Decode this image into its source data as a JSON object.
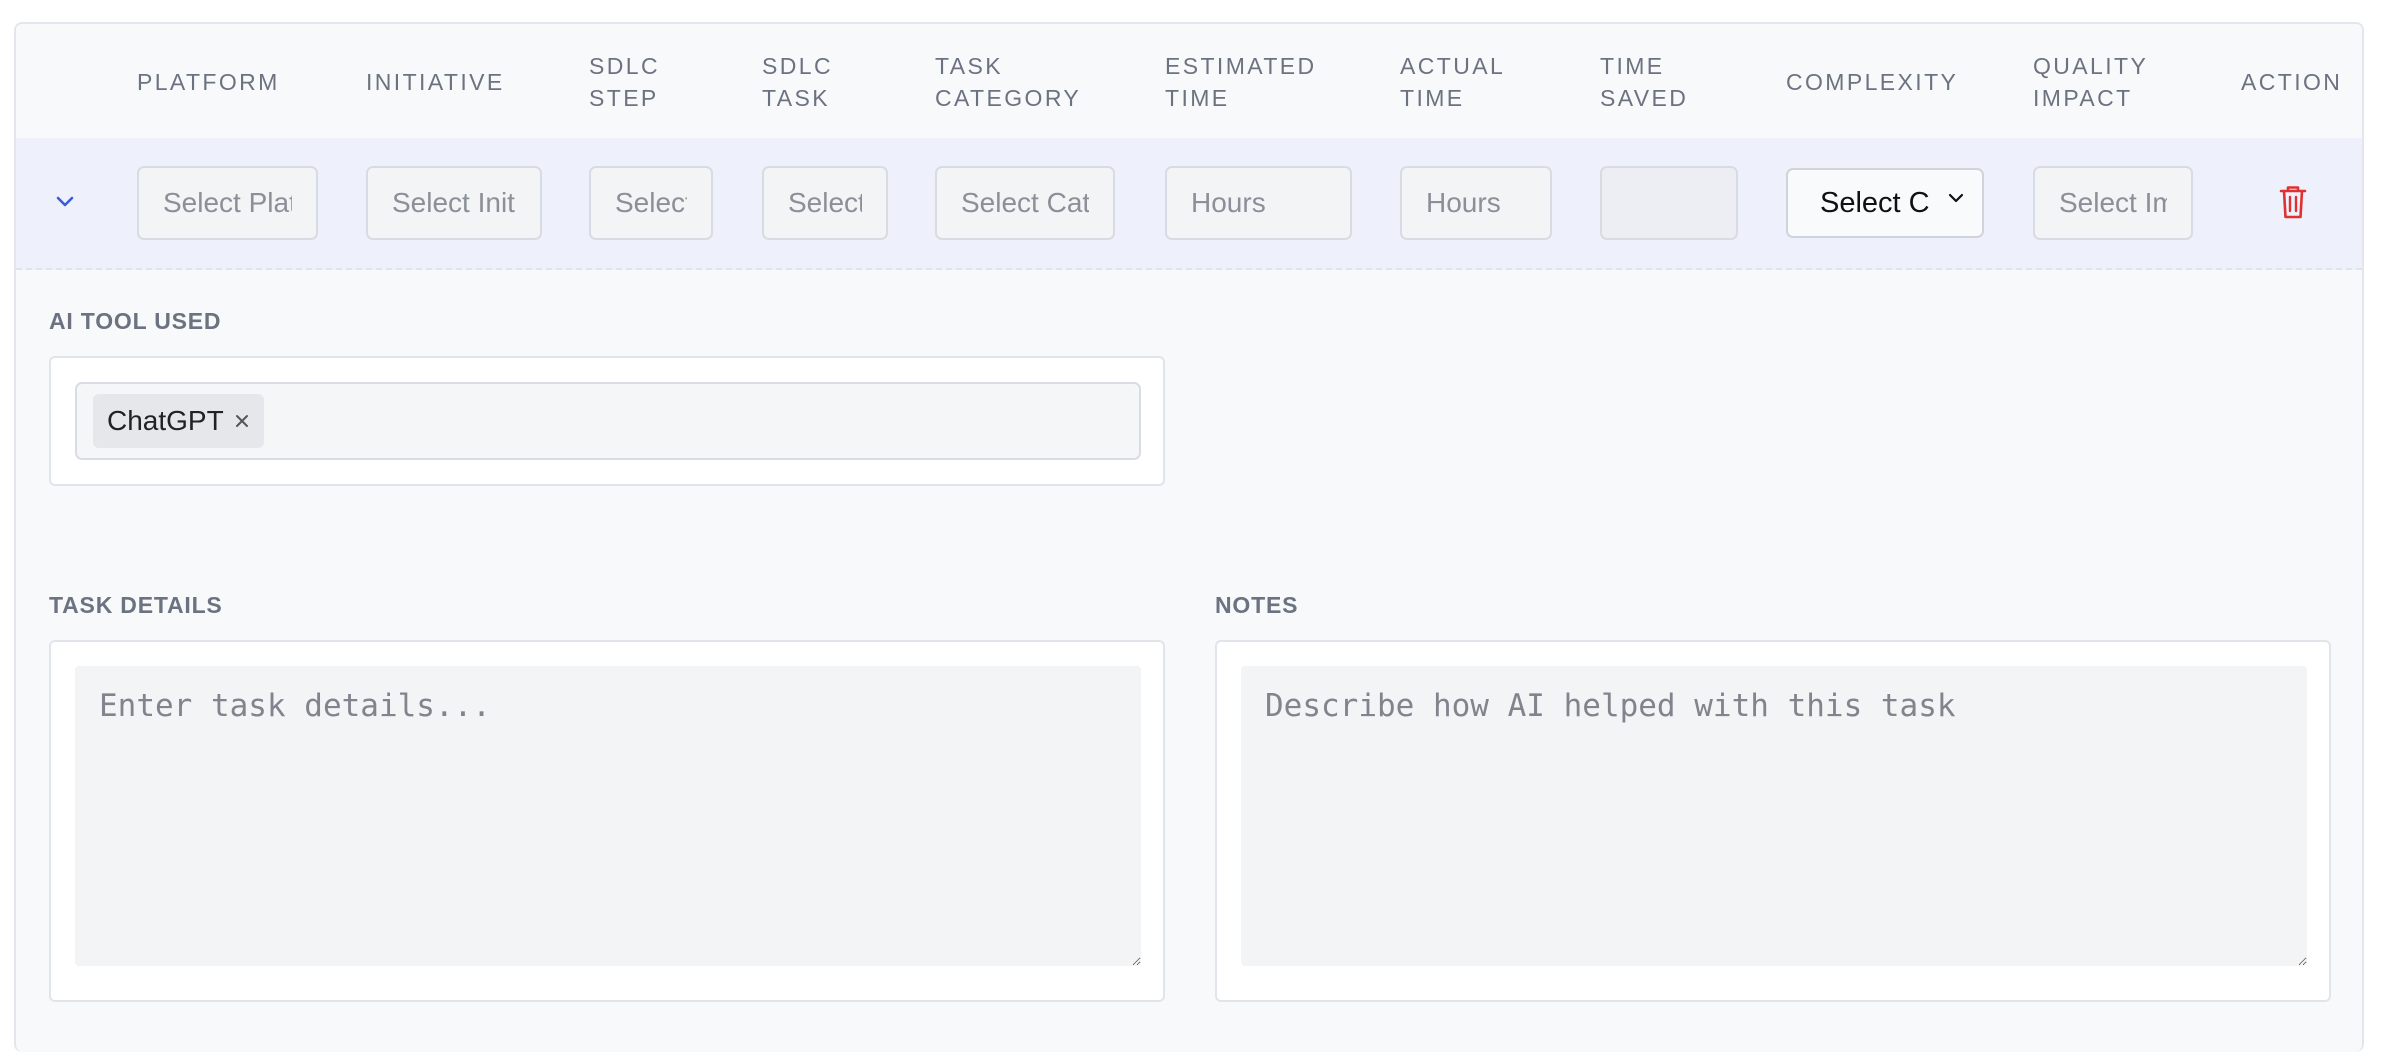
{
  "table": {
    "columns": [
      {
        "key": "platform",
        "label": "PLATFORM"
      },
      {
        "key": "initiative",
        "label": "INITIATIVE"
      },
      {
        "key": "sdlc_step",
        "label": "SDLC\nSTEP"
      },
      {
        "key": "sdlc_task",
        "label": "SDLC\nTASK"
      },
      {
        "key": "task_category",
        "label": "TASK\nCATEGORY"
      },
      {
        "key": "estimated_time",
        "label": "ESTIMATED\nTIME"
      },
      {
        "key": "actual_time",
        "label": "ACTUAL\nTIME"
      },
      {
        "key": "time_saved",
        "label": "TIME\nSAVED"
      },
      {
        "key": "complexity",
        "label": "COMPLEXITY"
      },
      {
        "key": "quality_impact",
        "label": "QUALITY\nIMPACT"
      },
      {
        "key": "action",
        "label": "ACTION"
      }
    ],
    "row": {
      "platform_placeholder": "Select Platform",
      "initiative_placeholder": "Select Initiative",
      "sdlc_step_placeholder": "Select SDLC Step",
      "sdlc_task_placeholder": "Select SDLC Task",
      "task_category_placeholder": "Select Category",
      "estimated_time_placeholder": "Hours",
      "actual_time_placeholder": "Hours",
      "time_saved_value": "",
      "complexity_selected": "Select C",
      "quality_impact_placeholder": "Select Impact"
    }
  },
  "details": {
    "ai_tool_label": "AI TOOL USED",
    "ai_tools": [
      "ChatGPT"
    ],
    "task_details_label": "TASK DETAILS",
    "task_details_placeholder": "Enter task details...",
    "notes_label": "NOTES",
    "notes_placeholder": "Describe how AI helped with this task"
  },
  "icons": {
    "expand": "chevron-down-icon",
    "delete": "trash-icon",
    "remove_tag": "close-icon",
    "select_arrow": "chevron-down-icon"
  },
  "colors": {
    "accent": "#3b5bdb",
    "danger": "#e03131",
    "row_highlight": "#eef1fb"
  }
}
